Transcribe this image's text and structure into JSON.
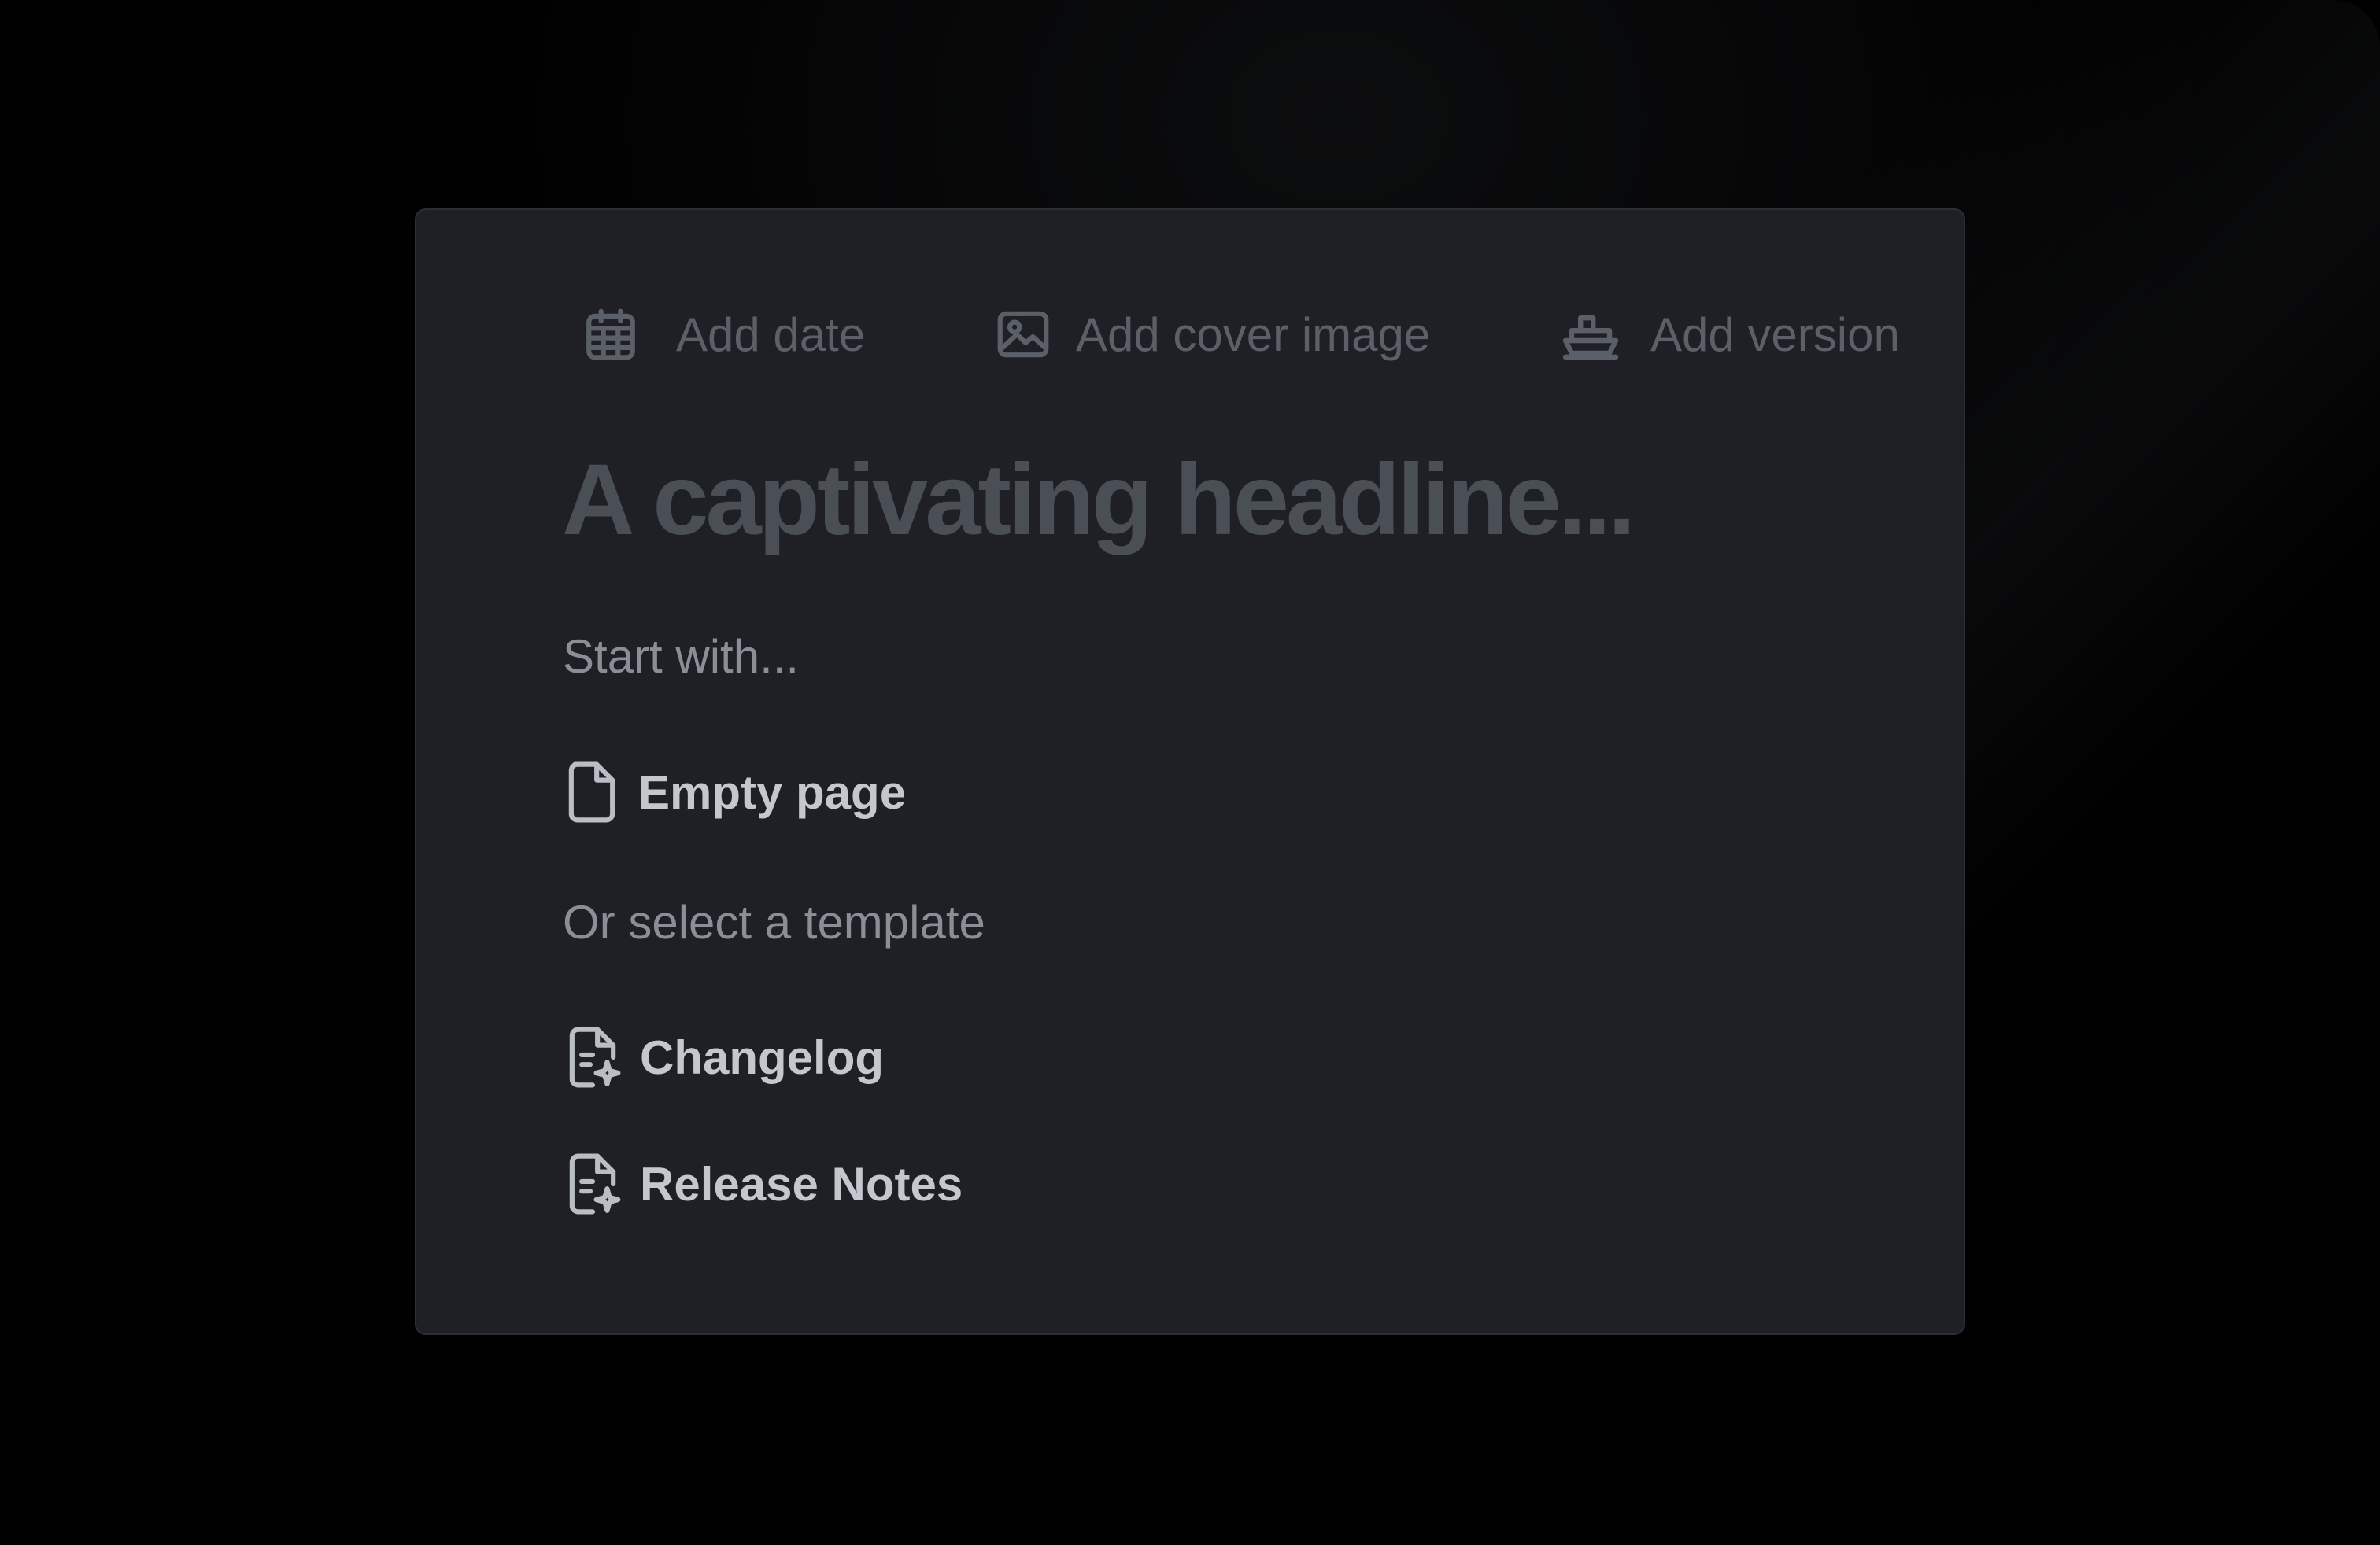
{
  "toolbar": {
    "add_date": {
      "label": "Add date",
      "icon": "calendar-icon"
    },
    "add_cover_image": {
      "label": "Add cover image",
      "icon": "image-icon"
    },
    "add_version": {
      "label": "Add version",
      "icon": "ship-icon"
    }
  },
  "editor": {
    "headline_placeholder": "A captivating headline...",
    "start_with_label": "Start with...",
    "empty_page": {
      "label": "Empty page",
      "icon": "file-icon"
    },
    "template_label": "Or select a template",
    "templates": [
      {
        "label": "Changelog",
        "icon": "file-sparkle-icon"
      },
      {
        "label": "Release Notes",
        "icon": "file-sparkle-icon"
      }
    ]
  },
  "colors": {
    "background": "#000000",
    "card": "#1e2025",
    "card_border": "#2b2e33",
    "toolbar_text": "#5b6068",
    "headline_placeholder": "#4a4e55",
    "muted_text": "#8a8f97",
    "option_text": "#c4c8ce"
  }
}
